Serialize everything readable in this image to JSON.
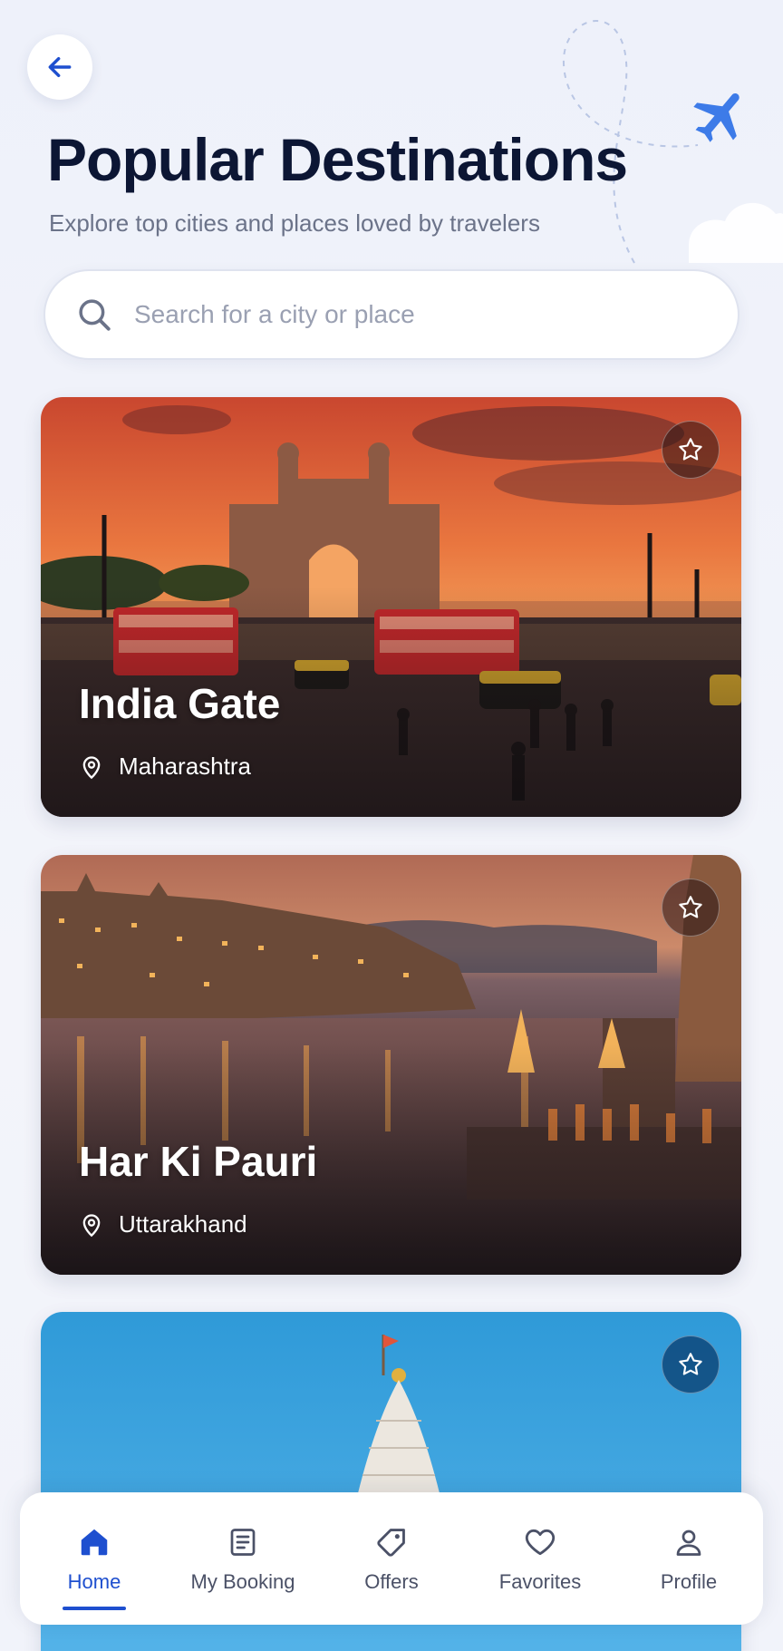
{
  "header": {
    "title": "Popular Destinations",
    "subtitle": "Explore top cities and places loved by travelers"
  },
  "search": {
    "placeholder": "Search for a city or place",
    "value": ""
  },
  "destinations": [
    {
      "name": "India Gate",
      "location": "Maharashtra",
      "favorite": false
    },
    {
      "name": "Har Ki Pauri",
      "location": "Uttarakhand",
      "favorite": false
    },
    {
      "name": "",
      "location": "",
      "favorite": false
    }
  ],
  "nav": {
    "items": [
      {
        "label": "Home",
        "icon": "home-icon",
        "active": true
      },
      {
        "label": "My Booking",
        "icon": "booking-icon",
        "active": false
      },
      {
        "label": "Offers",
        "icon": "tag-icon",
        "active": false
      },
      {
        "label": "Favorites",
        "icon": "heart-icon",
        "active": false
      },
      {
        "label": "Profile",
        "icon": "user-icon",
        "active": false
      }
    ]
  },
  "colors": {
    "accent": "#1e4fcf",
    "title": "#0c1634",
    "subtitle": "#6b7389",
    "plane": "#3d7be8"
  }
}
